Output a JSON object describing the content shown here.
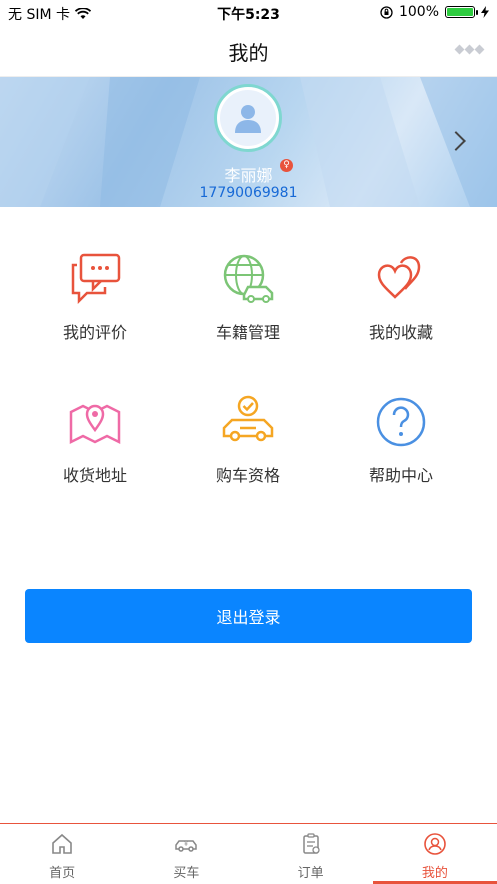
{
  "status_bar": {
    "carrier": "无 SIM 卡",
    "time": "下午5:23",
    "battery": "100%"
  },
  "nav": {
    "title": "我的"
  },
  "profile": {
    "name": "李丽娜",
    "phone": "17790069981",
    "gender": "female"
  },
  "menu": [
    {
      "label": "我的评价",
      "icon": "comment-icon",
      "color": "#e8533c"
    },
    {
      "label": "车籍管理",
      "icon": "globe-car-icon",
      "color": "#7cc576"
    },
    {
      "label": "我的收藏",
      "icon": "hearts-icon",
      "color": "#e8533c"
    },
    {
      "label": "收货地址",
      "icon": "map-pin-icon",
      "color": "#ef6aa6"
    },
    {
      "label": "购车资格",
      "icon": "car-check-icon",
      "color": "#f5a623"
    },
    {
      "label": "帮助中心",
      "icon": "help-icon",
      "color": "#4a90e2"
    }
  ],
  "logout": {
    "label": "退出登录",
    "color": "#0a85ff"
  },
  "tabs": [
    {
      "label": "首页",
      "icon": "home-icon"
    },
    {
      "label": "买车",
      "icon": "car-price-icon"
    },
    {
      "label": "订单",
      "icon": "order-icon"
    },
    {
      "label": "我的",
      "icon": "profile-icon",
      "active": true
    }
  ],
  "accent_color": "#e8533c"
}
